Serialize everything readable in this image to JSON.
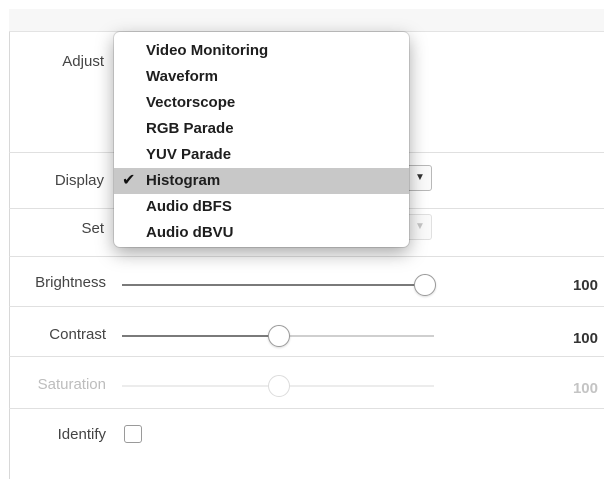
{
  "rows": {
    "adjust": {
      "label": "Adjust"
    },
    "display": {
      "label": "Display"
    },
    "set": {
      "label": "Set"
    },
    "brightness": {
      "label": "Brightness",
      "value": "100",
      "level": 1.0,
      "enabled": true
    },
    "contrast": {
      "label": "Contrast",
      "value": "100",
      "level": 0.5,
      "enabled": true
    },
    "saturation": {
      "label": "Saturation",
      "value": "100",
      "level": 0.5,
      "enabled": false
    },
    "identify": {
      "label": "Identify",
      "checked": false
    }
  },
  "dropdown": {
    "items": [
      {
        "label": "Video Monitoring",
        "selected": false
      },
      {
        "label": "Waveform",
        "selected": false
      },
      {
        "label": "Vectorscope",
        "selected": false
      },
      {
        "label": "RGB Parade",
        "selected": false
      },
      {
        "label": "YUV Parade",
        "selected": false
      },
      {
        "label": "Histogram",
        "selected": true
      },
      {
        "label": "Audio dBFS",
        "selected": false
      },
      {
        "label": "Audio dBVU",
        "selected": false
      }
    ],
    "check_glyph": "✔"
  },
  "colors": {
    "selected_bg": "#c8c8c8",
    "slider_fill": "#7a7a7a",
    "disabled_text": "#c4c4c4"
  },
  "icons": {
    "select_arrow": "chevron-down-icon",
    "check": "checkmark-icon"
  }
}
